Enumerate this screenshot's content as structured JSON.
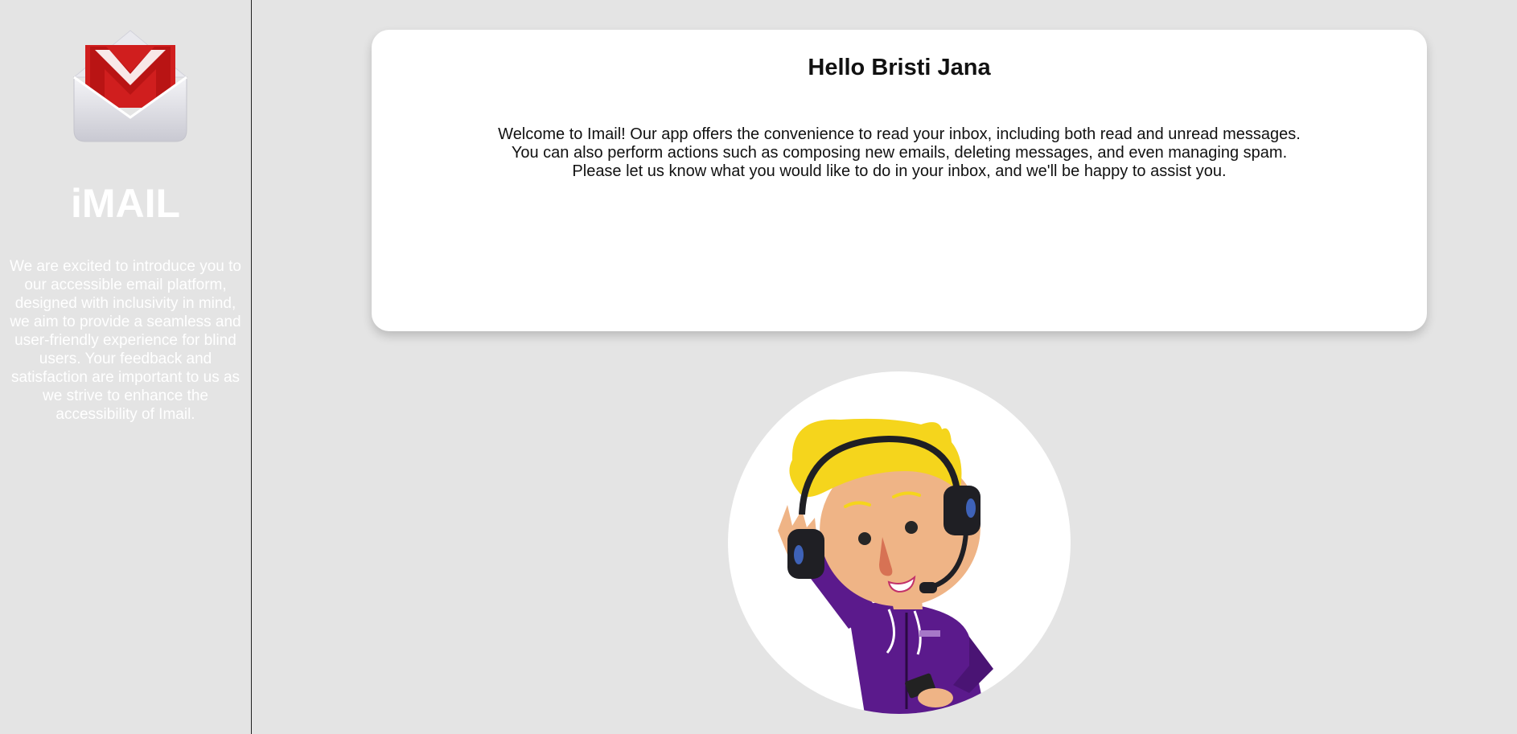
{
  "sidebar": {
    "logo_icon": "gmail-envelope-icon",
    "brand": "iMAIL",
    "intro": "We are excited to introduce you to our accessible email platform, designed with inclusivity in mind, we aim to provide a seamless and user-friendly experience for blind users. Your feedback and satisfaction are important to us as we strive to enhance the accessibility of Imail."
  },
  "main": {
    "greeting": "Hello Bristi Jana",
    "welcome_lines": [
      "Welcome to Imail! Our app offers the convenience to read your inbox, including both read and unread messages.",
      "You can also perform actions such as composing new emails, deleting messages, and even managing spam.",
      "Please let us know what you would like to do in your inbox, and we'll be happy to assist you."
    ],
    "avatar_icon": "assistant-headset-illustration"
  },
  "colors": {
    "background": "#e4e4e4",
    "card": "#ffffff",
    "logo_red": "#d01e1e",
    "hoodie_purple": "#5b1a8c",
    "hair_yellow": "#f5d51c"
  }
}
